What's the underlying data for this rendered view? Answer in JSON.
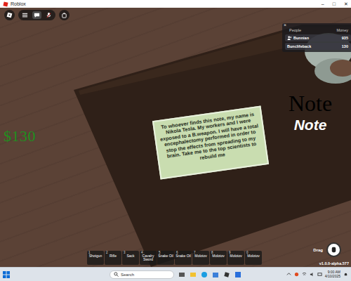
{
  "window": {
    "title": "Roblox",
    "controls": [
      "–",
      "□",
      "✕"
    ]
  },
  "money": "$130",
  "leaderboard": {
    "close": "×",
    "columns": [
      "People",
      "Money"
    ],
    "rows": [
      {
        "name": "Bunnian",
        "money": "935"
      },
      {
        "name": "Bunclifeback",
        "money": "130"
      }
    ]
  },
  "note": {
    "text": "To whoever finds this note, my name is Nikola Tesla. My workers and I were exposed to a B.weapon. I will have a total encephalectomy performed in order to stop the effects from spreading to my brain. Take me to the top scientists to rebuild me",
    "title": "Note",
    "subtitle": "Note"
  },
  "hotbar": [
    {
      "key": "1",
      "item": "Shotgun"
    },
    {
      "key": "2",
      "item": "Rifle"
    },
    {
      "key": "3",
      "item": "Sack"
    },
    {
      "key": "4",
      "item": "Cavalry Sword"
    },
    {
      "key": "5",
      "item": "Snake Oil"
    },
    {
      "key": "6",
      "item": "Snake Oil"
    },
    {
      "key": "7",
      "item": "Molotov"
    },
    {
      "key": "8",
      "item": "Molotov"
    },
    {
      "key": "9",
      "item": "Molotov"
    },
    {
      "key": "0",
      "item": "Molotov"
    }
  ],
  "drag": {
    "label": "Drag"
  },
  "version": "v1.0.0-alpha.577",
  "taskbar": {
    "search_placeholder": "Search",
    "time": "9:00 AM",
    "date": "4/10/2025"
  }
}
